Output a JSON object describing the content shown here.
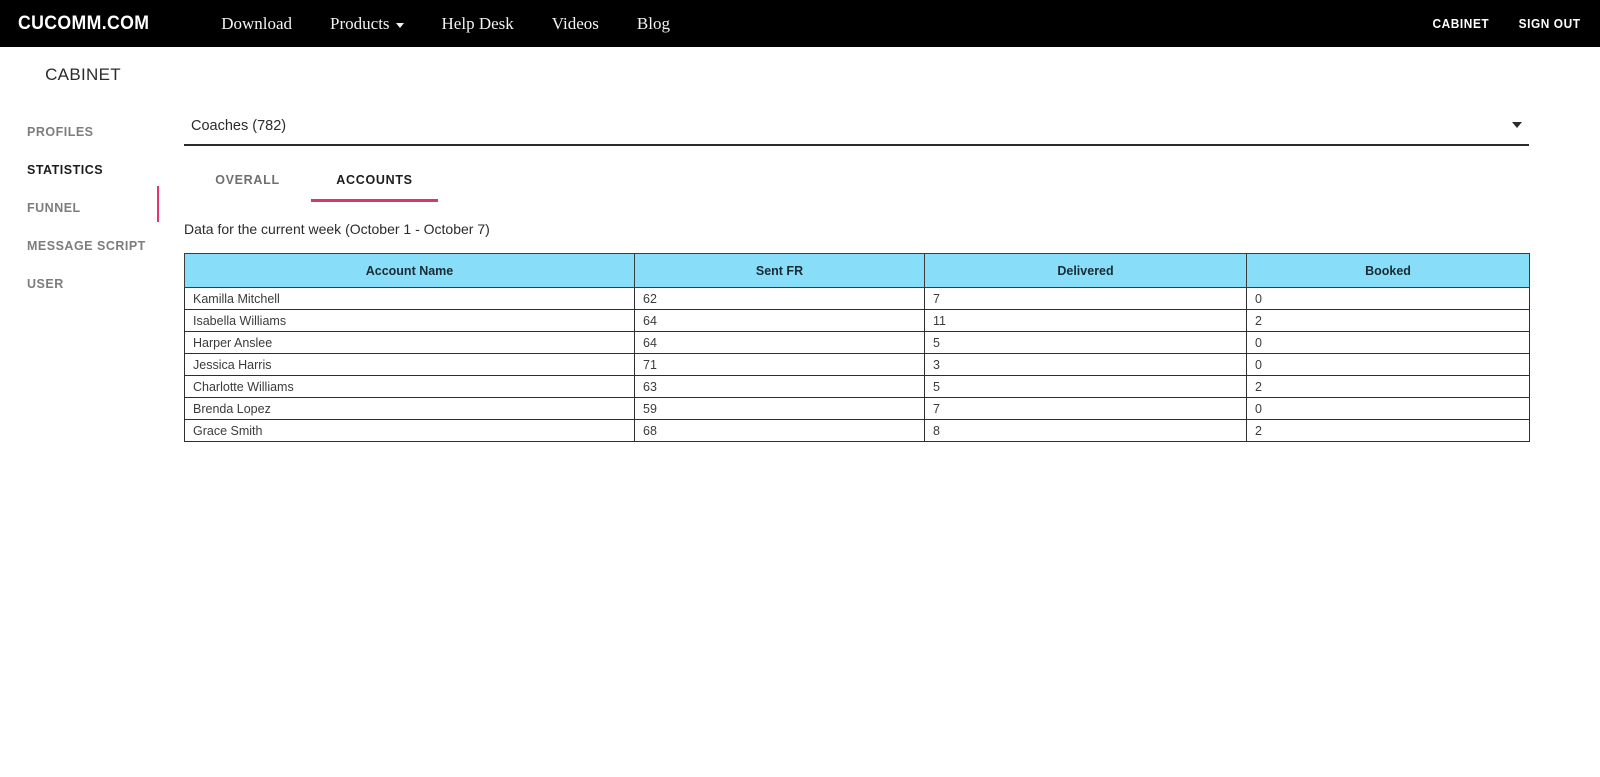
{
  "navbar": {
    "brand": "CUCOMM.COM",
    "links": [
      {
        "label": "Download",
        "has_caret": false
      },
      {
        "label": "Products",
        "has_caret": true
      },
      {
        "label": "Help Desk",
        "has_caret": false
      },
      {
        "label": "Videos",
        "has_caret": false
      },
      {
        "label": "Blog",
        "has_caret": false
      }
    ],
    "right_links": [
      {
        "label": "CABINET"
      },
      {
        "label": "SIGN OUT"
      }
    ]
  },
  "sidebar": {
    "title": "CABINET",
    "items": [
      {
        "label": "PROFILES",
        "active": false
      },
      {
        "label": "STATISTICS",
        "active": true
      },
      {
        "label": "FUNNEL",
        "active": false
      },
      {
        "label": "MESSAGE SCRIPT",
        "active": false
      },
      {
        "label": "USER",
        "active": false
      }
    ],
    "accent_color": "#e8336d"
  },
  "main": {
    "group_select": {
      "value": "Coaches (782)",
      "caret": "chevron-down-icon"
    },
    "tabs": [
      {
        "label": "OVERALL",
        "active": false
      },
      {
        "label": "ACCOUNTS",
        "active": true
      }
    ],
    "tab_accent_color": "#d6386b",
    "caption": "Data for the current week (October 1 - October 7)",
    "table": {
      "header_bg": "#88def8",
      "columns": [
        "Account Name",
        "Sent FR",
        "Delivered",
        "Booked"
      ],
      "rows": [
        {
          "name": "Kamilla Mitchell",
          "sent": "62",
          "delivered": "7",
          "booked": "0"
        },
        {
          "name": "Isabella Williams",
          "sent": "64",
          "delivered": "11",
          "booked": "2"
        },
        {
          "name": "Harper Anslee",
          "sent": "64",
          "delivered": "5",
          "booked": "0"
        },
        {
          "name": "Jessica Harris",
          "sent": "71",
          "delivered": "3",
          "booked": "0"
        },
        {
          "name": "Charlotte Williams",
          "sent": "63",
          "delivered": "5",
          "booked": "2"
        },
        {
          "name": "Brenda Lopez",
          "sent": "59",
          "delivered": "7",
          "booked": "0"
        },
        {
          "name": "Grace Smith",
          "sent": "68",
          "delivered": "8",
          "booked": "2"
        }
      ]
    }
  }
}
